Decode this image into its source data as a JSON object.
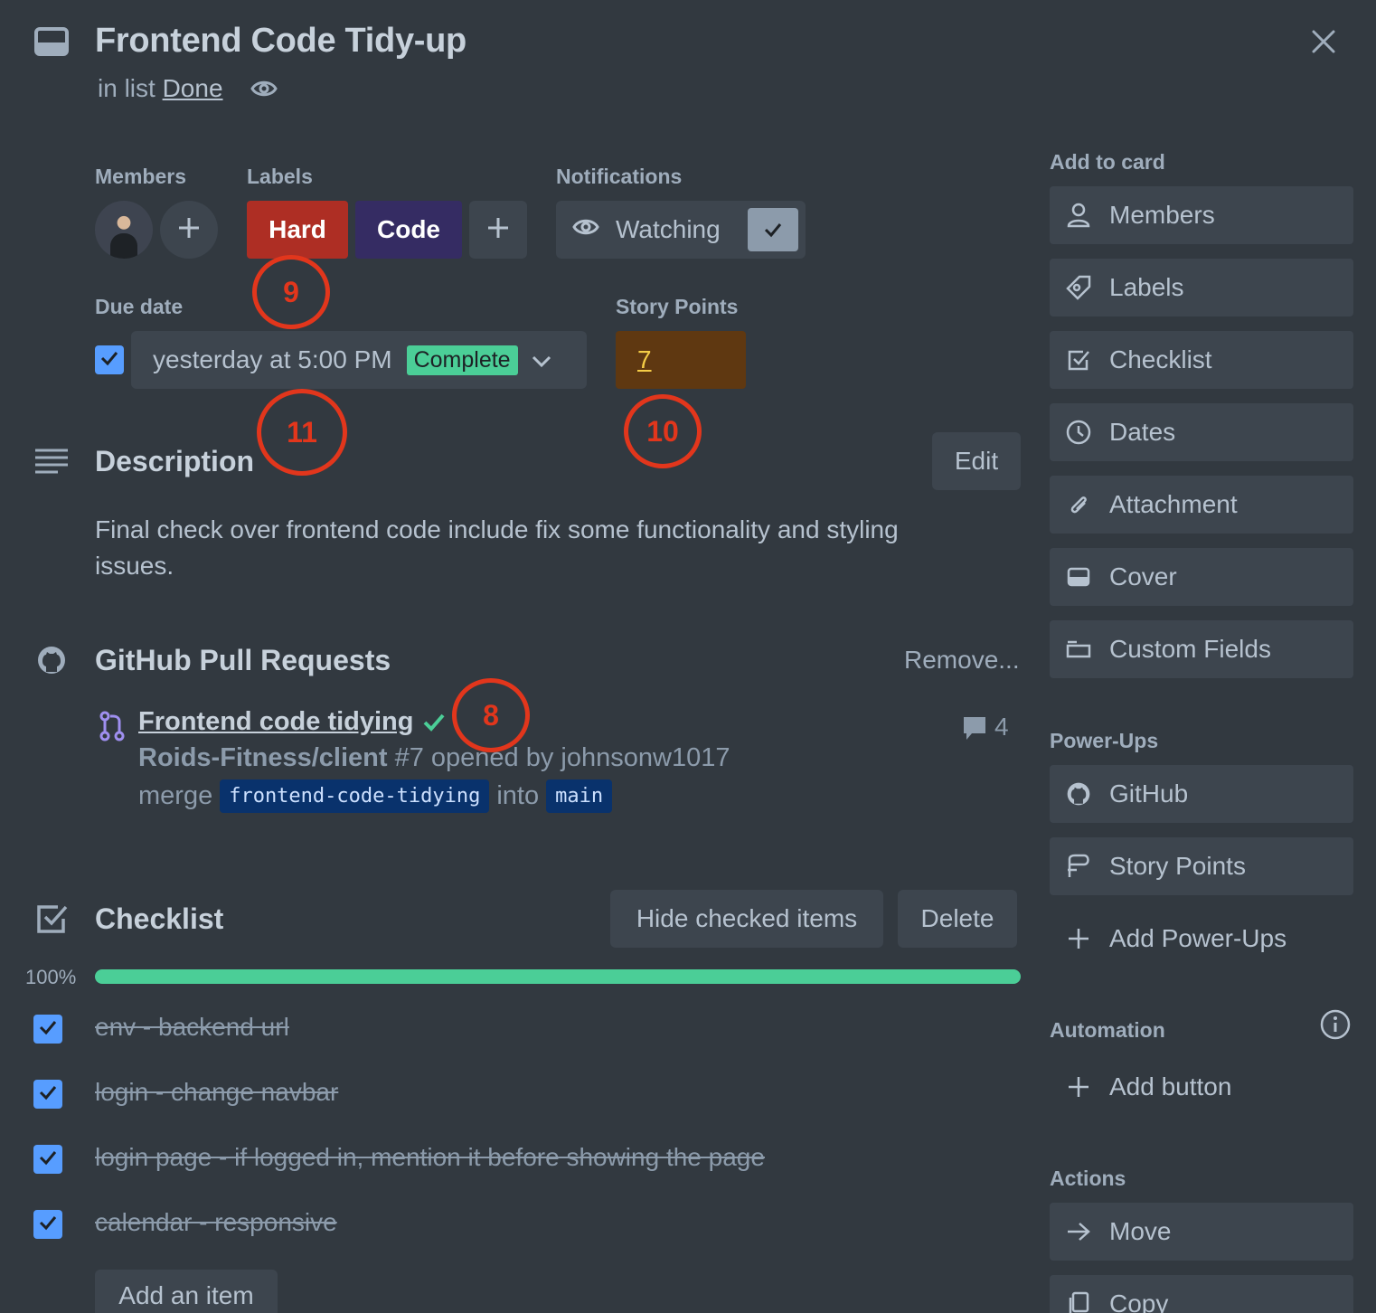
{
  "header": {
    "title": "Frontend Code Tidy-up",
    "in_list_prefix": "in list",
    "list_name": "Done"
  },
  "members": {
    "label": "Members"
  },
  "labels": {
    "label": "Labels",
    "items": [
      {
        "text": "Hard",
        "color": "#ae2e24"
      },
      {
        "text": "Code",
        "color": "#352c63"
      }
    ]
  },
  "notifications": {
    "label": "Notifications",
    "button": "Watching"
  },
  "due_date": {
    "label": "Due date",
    "value": "yesterday at 5:00 PM",
    "status": "Complete"
  },
  "story_points": {
    "label": "Story Points",
    "value": "7"
  },
  "annotations": [
    "9",
    "11",
    "10",
    "8"
  ],
  "description": {
    "title": "Description",
    "edit": "Edit",
    "text": "Final check over frontend code include fix some functionality and styling issues."
  },
  "github": {
    "title": "GitHub Pull Requests",
    "remove": "Remove...",
    "pr_title": "Frontend code tidying",
    "repo": "Roids-Fitness/client",
    "pr_info": " #7 opened by johnsonw1017",
    "merge": "merge",
    "from_branch": "frontend-code-tidying",
    "into": "into",
    "to_branch": "main",
    "comments": "4"
  },
  "checklist": {
    "title": "Checklist",
    "hide": "Hide checked items",
    "delete": "Delete",
    "percent": "100%",
    "progress": 1.0,
    "items": [
      "env - backend url",
      "login - change navbar",
      "login page - if logged in, mention it before showing the page",
      "calendar - responsive"
    ],
    "add_item": "Add an item"
  },
  "sidebar": {
    "add_to_card": "Add to card",
    "add_items": [
      "Members",
      "Labels",
      "Checklist",
      "Dates",
      "Attachment",
      "Cover",
      "Custom Fields"
    ],
    "powerups_label": "Power-Ups",
    "powerups": [
      "GitHub",
      "Story Points"
    ],
    "add_powerups": "Add Power-Ups",
    "automation_label": "Automation",
    "add_button": "Add button",
    "actions_label": "Actions",
    "actions": [
      "Move",
      "Copy"
    ]
  },
  "colors": {
    "background": "#323940",
    "progress": "#4bce97",
    "checkbox": "#579dff",
    "annotation": "#e2361c"
  }
}
